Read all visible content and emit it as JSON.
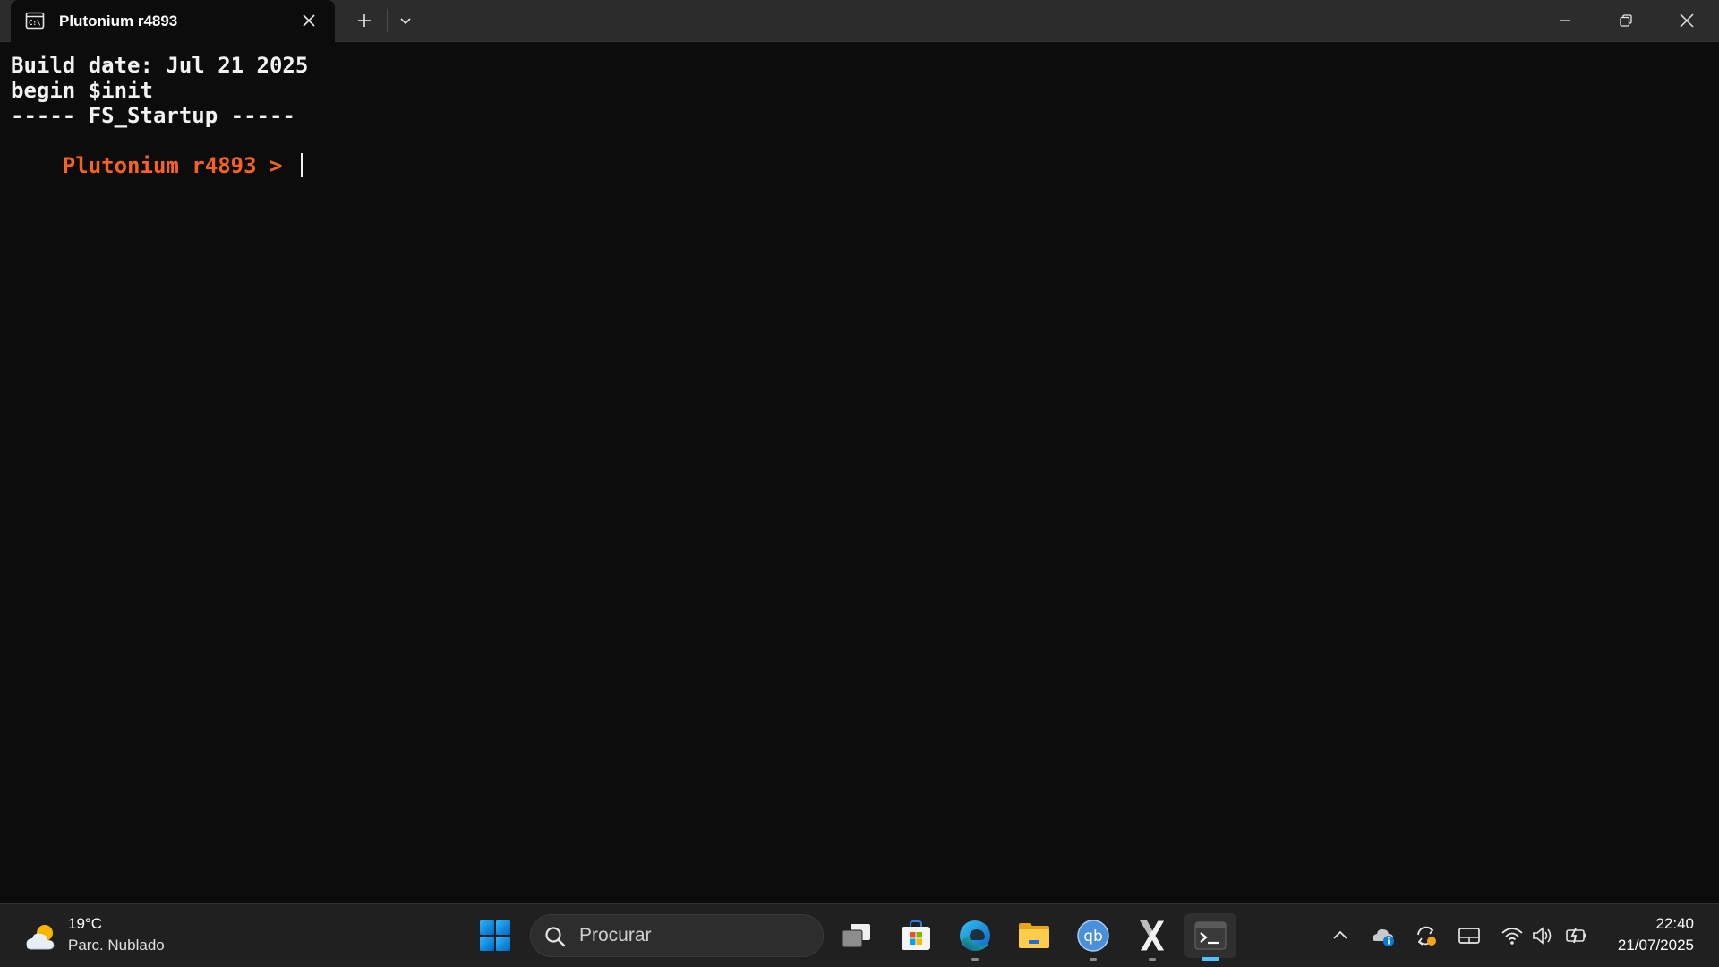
{
  "window": {
    "tab_title": "Plutonium r4893"
  },
  "terminal": {
    "lines": [
      "Build date: Jul 21 2025",
      "begin $init",
      "----- FS_Startup -----"
    ],
    "prompt": "Plutonium r4893 > ",
    "colors": {
      "text": "#f2f2f2",
      "prompt": "#f7631d",
      "background": "#0c0c0c"
    }
  },
  "taskbar": {
    "weather": {
      "temp": "19°C",
      "desc": "Parc. Nublado",
      "icon": "partly-cloudy-icon"
    },
    "search_placeholder": "Procurar",
    "apps": [
      "start-icon",
      "task-view-icon",
      "microsoft-store-icon",
      "edge-icon",
      "file-explorer-icon",
      "qbittorrent-icon",
      "x-app-icon",
      "terminal-icon"
    ],
    "tray": [
      "chevron-up-icon",
      "onedrive-icon",
      "sync-icon",
      "tablet-icon",
      "wifi-icon",
      "volume-icon",
      "battery-icon"
    ],
    "clock": {
      "time": "22:40",
      "date": "21/07/2025"
    },
    "accent": "#4cc2ff"
  }
}
